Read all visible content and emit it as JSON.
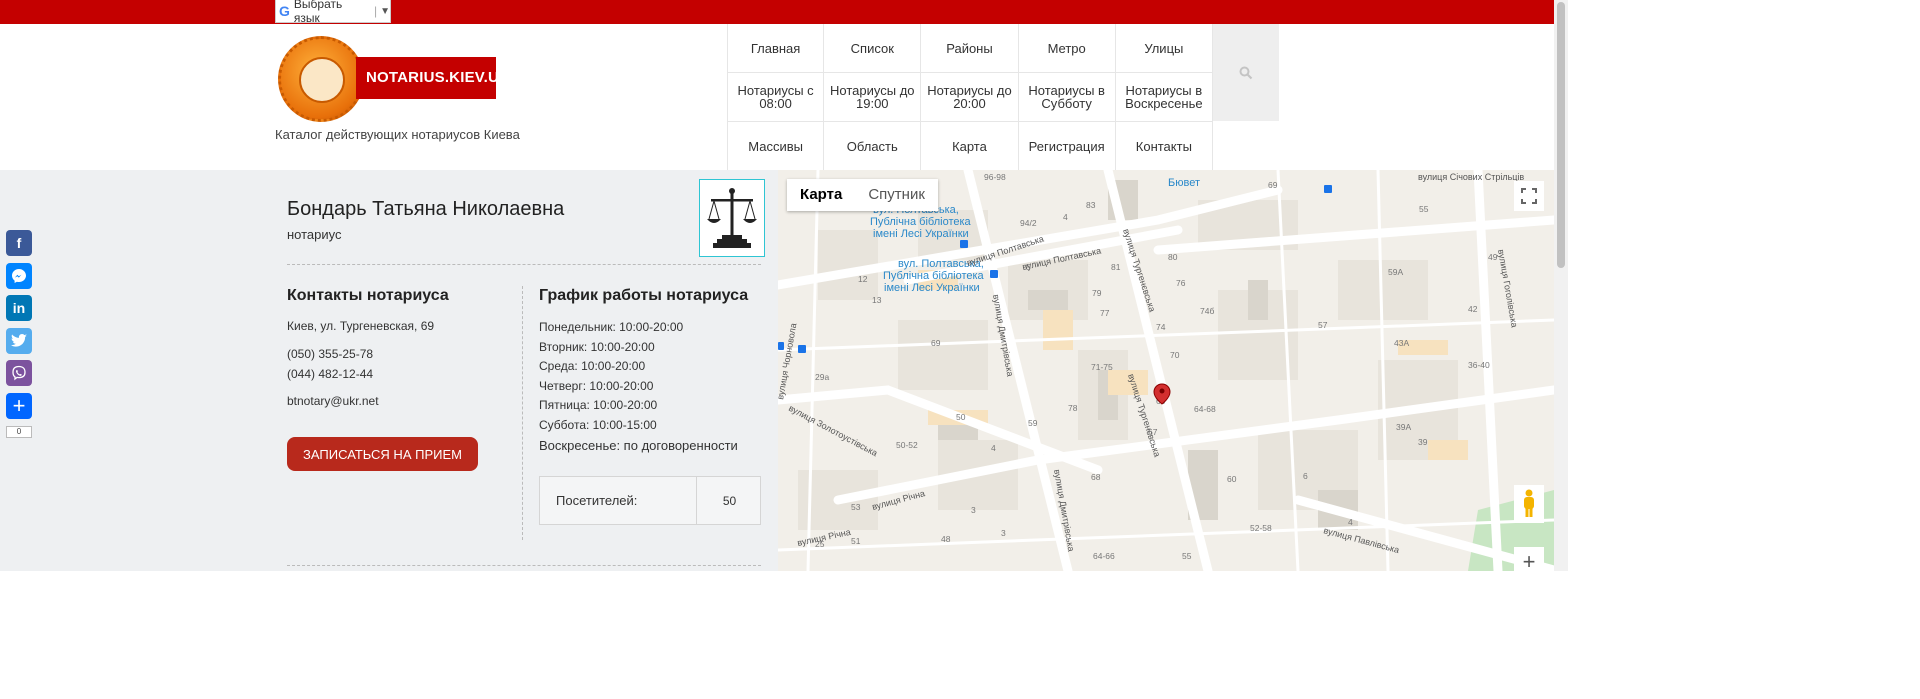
{
  "translate": {
    "label": "Выбрать язык",
    "g": "G",
    "sep": "|",
    "arrow": "▼"
  },
  "logo": {
    "seal_text": "NOTARIUS.KIEV.UA",
    "banner": "NOTARIUS.KIEV.UA"
  },
  "tagline": "Каталог действующих нотариусов Киева",
  "nav": [
    "Главная",
    "Список",
    "Районы",
    "Метро",
    "Улицы",
    "Нотариусы с 08:00",
    "Нотариусы до 19:00",
    "Нотариусы до 20:00",
    "Нотариусы в Субботу",
    "Нотариусы в Воскресенье",
    "Массивы",
    "Область",
    "Карта",
    "Регистрация",
    "Контакты"
  ],
  "social": {
    "count": "0",
    "items": [
      "facebook-icon",
      "messenger-icon",
      "linkedin-icon",
      "twitter-icon",
      "viber-icon",
      "share-icon"
    ],
    "colors": [
      "#3b5998",
      "#0084ff",
      "#0077b5",
      "#55acee",
      "#7c529e",
      "#0166ff"
    ]
  },
  "notary": {
    "name": "Бондарь Татьяна Николаевна",
    "role": "нотариус",
    "contacts_title": "Контакты нотариуса",
    "address": "Киев, ул. Тургеневская, 69",
    "phone1": "(050) 355-25-78",
    "phone2": "(044) 482-12-44",
    "email": "btnotary@ukr.net",
    "button": "ЗАПИСАТЬСЯ НА ПРИЕМ",
    "schedule_title": "График работы нотариуса",
    "schedule": [
      "Понедельник: 10:00-20:00",
      "Вторник: 10:00-20:00",
      "Среда: 10:00-20:00",
      "Четверг: 10:00-20:00",
      "Пятница: 10:00-20:00",
      "Суббота: 10:00-15:00",
      "Воскресенье: по договоренности"
    ],
    "visitors_label": "Посетителей:",
    "visitors_value": "50"
  },
  "map": {
    "tab_map": "Карта",
    "tab_sat": "Спутник",
    "labels": [
      "вул. Полтавська, Публічна бібліотека імені Лесі Українки",
      "вулиця Полтавська",
      "вулиця Тургенєвська",
      "вулиця Дмитрівська",
      "вулиця Золотоустівська",
      "вулиця Річна",
      "вулиця Павлівська",
      "вулиця Січових Стрільців",
      "вулиця Гоголівська",
      "Бювет",
      "вулиця Чорновола"
    ],
    "numbers": [
      "96-98",
      "83",
      "94/2",
      "4",
      "81",
      "80",
      "69",
      "55",
      "12",
      "13",
      "79",
      "76",
      "74б",
      "59А",
      "57",
      "49",
      "77",
      "74",
      "70",
      "43А",
      "42",
      "36-40",
      "69",
      "71-75",
      "64-68",
      "39А",
      "39",
      "29а",
      "50",
      "78",
      "67",
      "69",
      "50-52",
      "4",
      "59",
      "68",
      "60",
      "6",
      "53",
      "3",
      "52-58",
      "4",
      "25",
      "51",
      "48",
      "64-66",
      "55",
      "3",
      "5"
    ]
  }
}
